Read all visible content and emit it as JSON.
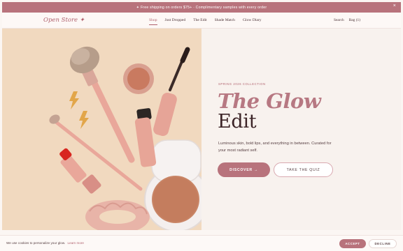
{
  "promo": {
    "text": "✦ Free shipping on orders $75+ · Complimentary samples with every order",
    "close": "×"
  },
  "nav": {
    "logo": "Open Store ✦",
    "links": [
      "Shop",
      "Just Dropped",
      "The Edit",
      "Shade Match",
      "Glow Diary"
    ],
    "active_index": 0,
    "search": "Search",
    "bag": "Bag (1)"
  },
  "hero": {
    "eyebrow": "SPRING 2026 COLLECTION",
    "title_line1": "The Glow",
    "title_line2": "Edit",
    "description": "Luminous skin, bold lips, and everything in between. Curated for your most radiant self.",
    "primary_cta": "DISCOVER →",
    "secondary_cta": "TAKE THE QUIZ"
  },
  "cookie": {
    "text": "We use cookies to personalize your glow.",
    "link": "Learn more",
    "accept": "ACCEPT",
    "decline": "DECLINE"
  },
  "colors": {
    "accent": "#b8737c",
    "hero_bg": "#f1d9bf",
    "panel_bg": "#f8f2ee",
    "heading_dark": "#3c2427"
  },
  "icons": [
    "close-icon",
    "sparkle-icon",
    "arrow-right-icon"
  ]
}
